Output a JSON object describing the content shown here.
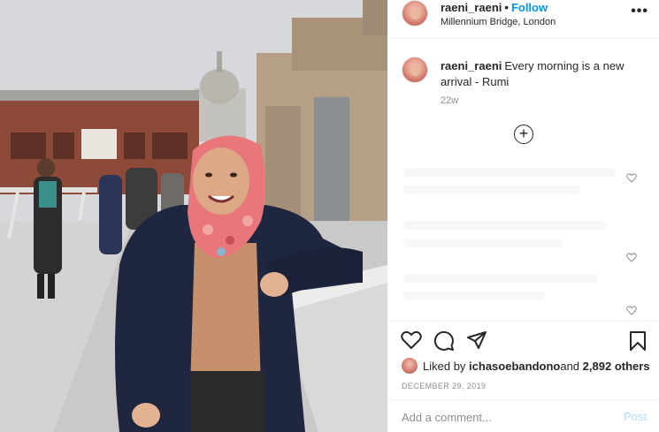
{
  "header": {
    "username": "raeni_raeni",
    "separator": "•",
    "follow_label": "Follow",
    "location": "Millennium Bridge, London",
    "more_glyph": "•••"
  },
  "caption": {
    "username": "raeni_raeni",
    "text": "Every morning is a new arrival - Rumi",
    "time": "22w"
  },
  "load_more_glyph": "+",
  "actions": {
    "like_icon": "heart-icon",
    "comment_icon": "comment-icon",
    "share_icon": "paper-plane-icon",
    "save_icon": "bookmark-icon"
  },
  "likes": {
    "prefix": "Liked by ",
    "user": "ichasoebandono",
    "middle": " and ",
    "count": "2,892 others"
  },
  "date": "DECEMBER 29, 2019",
  "comment": {
    "placeholder": "Add a comment...",
    "post_label": "Post"
  },
  "colors": {
    "link_blue": "#0095f6",
    "post_disabled": "#b3dbff",
    "muted": "#8e8e8e",
    "hijab_pink": "#e8767a",
    "jacket_navy": "#1f2640"
  }
}
